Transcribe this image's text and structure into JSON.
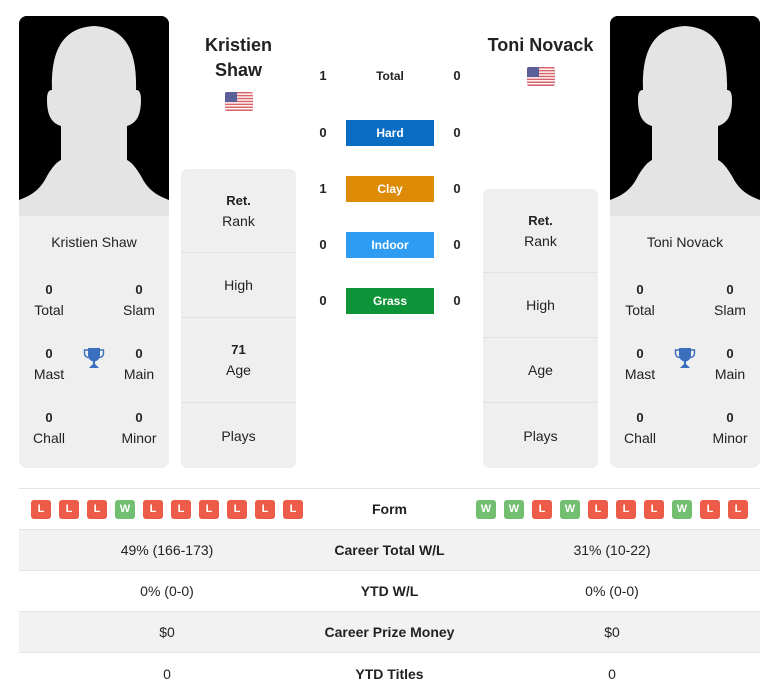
{
  "colors": {
    "hard": "#0a6dc4",
    "clay": "#de8b08",
    "indoor": "#2f9cf3",
    "grass": "#0d9438",
    "win": "#72bf72",
    "loss": "#ec5c48",
    "trophy": "#3a6fbe"
  },
  "player1": {
    "heading_line1": "Kristien",
    "heading_line2": "Shaw",
    "card_name": "Kristien Shaw",
    "flag_icon": "us-flag-icon",
    "titles": {
      "total": {
        "value": "0",
        "label": "Total"
      },
      "slam": {
        "value": "0",
        "label": "Slam"
      },
      "mast": {
        "value": "0",
        "label": "Mast"
      },
      "main": {
        "value": "0",
        "label": "Main"
      },
      "chall": {
        "value": "0",
        "label": "Chall"
      },
      "minor": {
        "value": "0",
        "label": "Minor"
      }
    },
    "info": {
      "rank_value": "Ret.",
      "rank_label": "Rank",
      "high_label": "High",
      "age_value": "71",
      "age_label": "Age",
      "plays_label": "Plays"
    }
  },
  "player2": {
    "heading": "Toni Novack",
    "card_name": "Toni Novack",
    "flag_icon": "us-flag-icon",
    "titles": {
      "total": {
        "value": "0",
        "label": "Total"
      },
      "slam": {
        "value": "0",
        "label": "Slam"
      },
      "mast": {
        "value": "0",
        "label": "Mast"
      },
      "main": {
        "value": "0",
        "label": "Main"
      },
      "chall": {
        "value": "0",
        "label": "Chall"
      },
      "minor": {
        "value": "0",
        "label": "Minor"
      }
    },
    "info": {
      "rank_value": "Ret.",
      "rank_label": "Rank",
      "high_label": "High",
      "age_label": "Age",
      "plays_label": "Plays"
    }
  },
  "h2h": [
    {
      "label": "Total",
      "left": "1",
      "right": "0",
      "type": "total"
    },
    {
      "label": "Hard",
      "left": "0",
      "right": "0",
      "type": "hard"
    },
    {
      "label": "Clay",
      "left": "1",
      "right": "0",
      "type": "clay"
    },
    {
      "label": "Indoor",
      "left": "0",
      "right": "0",
      "type": "indoor"
    },
    {
      "label": "Grass",
      "left": "0",
      "right": "0",
      "type": "grass"
    }
  ],
  "form": {
    "label": "Form",
    "player1": [
      "L",
      "L",
      "L",
      "W",
      "L",
      "L",
      "L",
      "L",
      "L",
      "L"
    ],
    "player2": [
      "W",
      "W",
      "L",
      "W",
      "L",
      "L",
      "L",
      "W",
      "L",
      "L"
    ]
  },
  "stats": [
    {
      "label": "Career Total W/L",
      "left": "49% (166-173)",
      "right": "31% (10-22)"
    },
    {
      "label": "YTD W/L",
      "left": "0% (0-0)",
      "right": "0% (0-0)"
    },
    {
      "label": "Career Prize Money",
      "left": "$0",
      "right": "$0"
    },
    {
      "label": "YTD Titles",
      "left": "0",
      "right": "0"
    }
  ]
}
